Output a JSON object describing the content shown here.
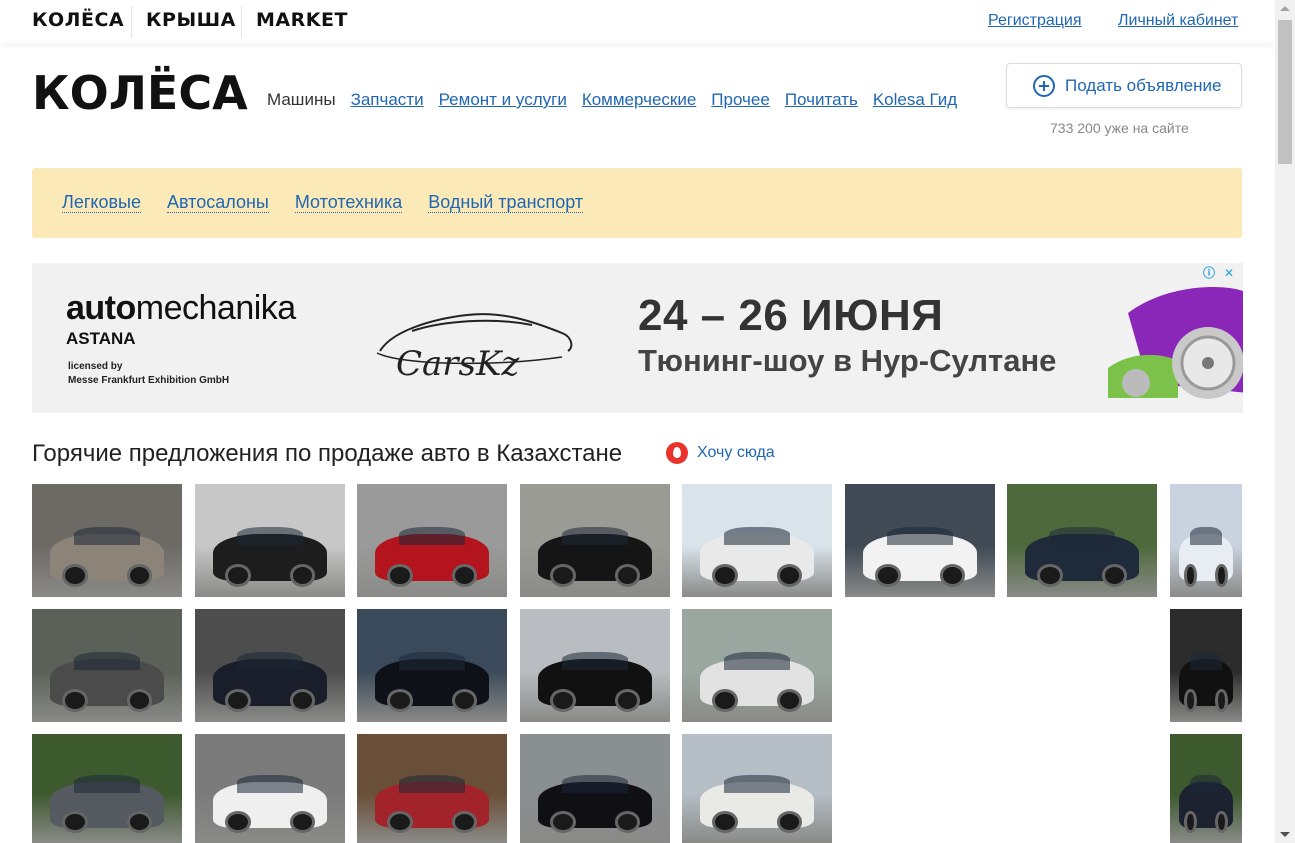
{
  "topbar": {
    "brands": [
      "КОЛЁСА",
      "КРЫША",
      "MARKET"
    ],
    "register": "Регистрация",
    "cabinet": "Личный кабинет"
  },
  "header": {
    "logo": "КОЛЁСА",
    "nav": [
      "Машины",
      "Запчасти",
      "Ремонт и услуги",
      "Коммерческие",
      "Прочее",
      "Почитать",
      "Kolesa Гид"
    ],
    "post_button": "Подать объявление",
    "counter": "733 200 уже на сайте"
  },
  "categories": [
    "Легковые",
    "Автосалоны",
    "Мототехника",
    "Водный транспорт"
  ],
  "banner": {
    "brand_bold": "auto",
    "brand_thin": "mechanika",
    "city": "ASTANA",
    "license_1": "licensed by",
    "license_2": "Messe Frankfurt Exhibition GmbH",
    "partner": "CarsKz",
    "dates": "24 – 26 ИЮНЯ",
    "event": "Тюнинг-шоу в Нур-Султане"
  },
  "hot": {
    "title": "Горячие предложения по продаже авто в Казахстане",
    "cta": "Хочу сюда"
  },
  "colors": {
    "link": "#1f67b4",
    "category_bar": "#fbe9b8",
    "fire": "#e8342d"
  }
}
